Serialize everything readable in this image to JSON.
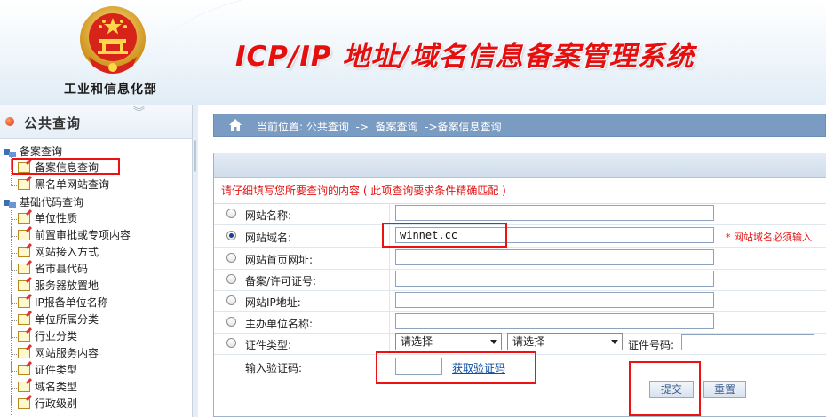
{
  "header": {
    "ministry": "工业和信息化部",
    "system_title": "ICP/IP 地址/域名信息备案管理系统"
  },
  "sidebar": {
    "title": "公共查询",
    "groups": [
      {
        "label": "备案查询",
        "items": [
          "备案信息查询",
          "黑名单网站查询"
        ]
      },
      {
        "label": "基础代码查询",
        "items": [
          "单位性质",
          "前置审批或专项内容",
          "网站接入方式",
          "省市县代码",
          "服务器放置地",
          "IP报备单位名称",
          "单位所属分类",
          "行业分类",
          "网站服务内容",
          "证件类型",
          "域名类型",
          "行政级别"
        ]
      }
    ]
  },
  "breadcrumb": {
    "text": "当前位置: 公共查询  ->  备案查询  ->备案信息查询"
  },
  "form": {
    "note": "请仔细填写您所要查询的内容 ( 此项查询要求条件精确匹配 )",
    "fields": [
      {
        "label": "网站名称:",
        "value": "",
        "selected": false
      },
      {
        "label": "网站域名:",
        "value": "winnet.cc",
        "selected": true,
        "required_note": "* 网站域名必须输入"
      },
      {
        "label": "网站首页网址:",
        "value": "",
        "selected": false
      },
      {
        "label": "备案/许可证号:",
        "value": "",
        "selected": false
      },
      {
        "label": "网站IP地址:",
        "value": "",
        "selected": false
      },
      {
        "label": "主办单位名称:",
        "value": "",
        "selected": false
      }
    ],
    "cert": {
      "label": "证件类型:",
      "select1": "请选择",
      "select2": "请选择",
      "number_label": "证件号码:",
      "number_value": ""
    },
    "captcha": {
      "label": "输入验证码:",
      "value": "",
      "link": "获取验证码"
    },
    "submit_label": "提交",
    "reset_label": "重置"
  },
  "colors": {
    "title_red": "#e60f0f",
    "crumb_bar": "#7a9bc2",
    "highlight_box": "#ee1111",
    "note_red": "#e21515"
  }
}
